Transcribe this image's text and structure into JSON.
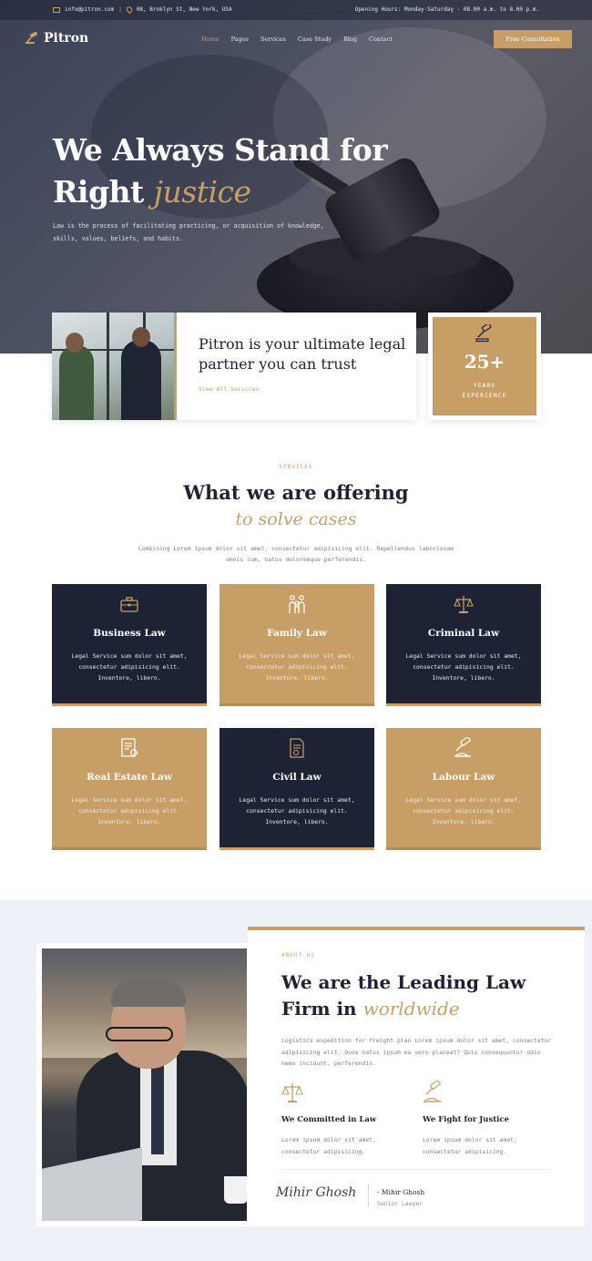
{
  "topbar": {
    "email": "info@pitron.com",
    "address": "08, Broklyn St, New York, USA",
    "hours": "Opening Hours: Monday-Saturday - 08.00 a.m. to 8.00 p.m."
  },
  "nav": {
    "logo": "Pitron",
    "links": [
      "Home",
      "Pages",
      "Services",
      "Case Study",
      "Blog",
      "Contact"
    ],
    "cta": "Free Consultation"
  },
  "hero": {
    "title_line1": "We Always Stand for",
    "title_line2_plain": "Right",
    "title_line2_accent": "justice",
    "description": "Law is the process of facilitating practicing, or acquisition of knowledge, skills, values, beliefs, and habits."
  },
  "intro": {
    "headline": "Pitron is your ultimate legal partner you can trust",
    "link": "View All Services",
    "experience_number": "25+",
    "experience_label_line1": "YEARS",
    "experience_label_line2": "EXPERIENCE"
  },
  "services": {
    "eyebrow": "SERVICES",
    "title": "What we are offering",
    "title_accent": "to solve cases",
    "description": "Combining Lorem ipsum dolor sit amet, consectetur adipisicing elit. Repellendus laboriosam omnis cum, natus doloremque perferendis.",
    "items": [
      {
        "title": "Business Law",
        "desc": "Legal Service sum dolor sit amet, consectetur adipisicing elit. Inventore, libero.",
        "icon": "briefcase-icon",
        "theme": "dark"
      },
      {
        "title": "Family Law",
        "desc": "Legal Service sum dolor sit amet, consectetur adipisicing elit. Inventore, libero.",
        "icon": "family-icon",
        "theme": "gold"
      },
      {
        "title": "Criminal Law",
        "desc": "Legal Service sum dolor sit amet, consectetur adipisicing elit. Inventore, libero.",
        "icon": "scales-icon",
        "theme": "dark"
      },
      {
        "title": "Real Estate Law",
        "desc": "Legal Service sum dolor sit amet, consectetur adipisicing elit. Inventore, libero.",
        "icon": "contract-icon",
        "theme": "gold"
      },
      {
        "title": "Civil Law",
        "desc": "Legal Service sum dolor sit amet, consectetur adipisicing elit. Inventore, libero.",
        "icon": "document-icon",
        "theme": "dark"
      },
      {
        "title": "Labour Law",
        "desc": "Legal Service sum dolor sit amet, consectetur adipisicing elit. Inventore, libero.",
        "icon": "gavel-icon",
        "theme": "gold"
      }
    ]
  },
  "about": {
    "eyebrow": "ABOUT US",
    "title_line1": "We are the Leading Law",
    "title_line2_plain": "Firm in",
    "title_line2_accent": "worldwide",
    "description": "Logistics expedition for freight plan Lorem ipsum dolor sit amet, consectetur adipisicing elit. Quos natus ipsum ea vero placeat? Quis consequuntur odio nemo incidunt, perferendis.",
    "features": [
      {
        "title": "We Committed in Law",
        "desc": "Lorem ipsum dolor sit amet, consectetur adipisicing.",
        "icon": "scales-icon"
      },
      {
        "title": "We Fight for Justice",
        "desc": "Lorem ipsum dolor sit amet, consectetur adipisicing.",
        "icon": "gavel-icon"
      }
    ],
    "signature": "Mihir Ghosh",
    "signer_name": "- Mihir Ghosh",
    "signer_role": "Senior Lawyer"
  },
  "colors": {
    "navy": "#1e2235",
    "gold": "#c79f66",
    "about_bg": "#edf0f7"
  }
}
